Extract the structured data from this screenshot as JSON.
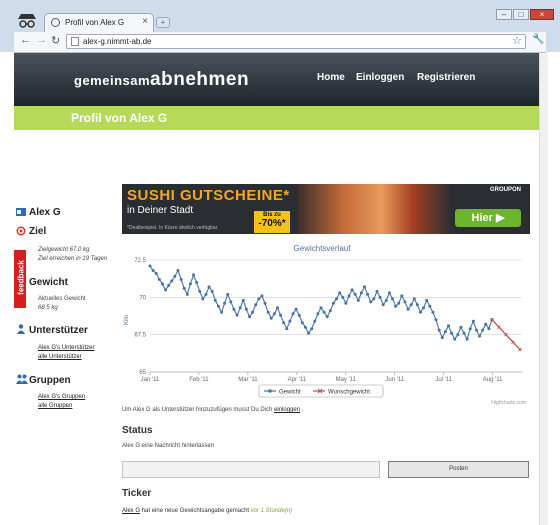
{
  "browser": {
    "tab_title": "Profil von Alex G",
    "tab_close": "×",
    "new_tab": "+",
    "url": "alex-g.nimmt-ab.de",
    "window_buttons": [
      "–",
      "□",
      "×"
    ]
  },
  "site": {
    "logo_prefix": "gemeinsam",
    "logo_main": "abnehmen",
    "nav": [
      "Home",
      "Einloggen",
      "Registrieren"
    ],
    "page_title": "Profil von Alex G"
  },
  "ad": {
    "headline": "SUSHI GUTSCHEINE*",
    "subline": "in Deiner Stadt",
    "footnote": "*Dealbeispiel. In Kürze ähnlich verfügbar.",
    "discount_label": "Bis zu",
    "discount_value": "-70%*",
    "brand": "GROUPON",
    "cta": "Hier ▶"
  },
  "sidebar": {
    "feedback": "feedback",
    "user_name": "Alex G",
    "goal_title": "Ziel",
    "goal_weight": "Zielgewicht 67.0 kg",
    "goal_end": "Ziel erreichen in 19 Tagen",
    "weight_title": "Gewicht",
    "current_label": "Aktuelles Gewicht",
    "current_value": "68.5 kg",
    "supporters_title": "Unterstützer",
    "supporters_link1": "Alex G's Unterstützer",
    "supporters_link2": "alle Unterstützer",
    "groups_title": "Gruppen",
    "groups_link1": "Alex G's Gruppen",
    "groups_link2": "alle Gruppen"
  },
  "chart_data": {
    "type": "line",
    "title": "Gewichtsverlauf",
    "ylabel": "Kilo",
    "xlabel": "",
    "x_ticks": [
      "Jan '11",
      "Feb '11",
      "Mar '11",
      "Apr '11",
      "May '11",
      "Jun '11",
      "Jul '11",
      "Aug '11"
    ],
    "y_ticks": [
      65,
      67.5,
      70,
      72.5
    ],
    "ylim": [
      65,
      72.5
    ],
    "legend": [
      "Gewicht",
      "Wunschgewicht"
    ],
    "credit": "Highcharts.com",
    "colors": {
      "weight": "#4572a7",
      "target": "#c0504d"
    },
    "series": [
      {
        "name": "Gewicht",
        "values": [
          72.1,
          71.8,
          71.6,
          71.2,
          70.9,
          70.5,
          70.8,
          71.1,
          71.4,
          71.8,
          71.2,
          70.6,
          70.2,
          70.9,
          71.5,
          71.0,
          70.4,
          69.9,
          70.2,
          70.7,
          70.4,
          69.8,
          69.4,
          69.0,
          69.6,
          70.2,
          69.7,
          69.2,
          68.8,
          69.3,
          69.8,
          69.2,
          68.7,
          69.0,
          69.5,
          69.9,
          70.1,
          69.6,
          69.0,
          68.6,
          68.9,
          69.3,
          68.8,
          68.3,
          67.9,
          68.4,
          68.9,
          69.2,
          68.8,
          68.3,
          68.0,
          67.6,
          67.9,
          68.4,
          68.9,
          69.3,
          69.0,
          68.7,
          69.1,
          69.6,
          69.9,
          70.3,
          70.0,
          69.6,
          70.1,
          70.5,
          70.2,
          69.8,
          70.3,
          70.7,
          70.2,
          69.7,
          69.9,
          70.4,
          70.0,
          69.5,
          69.8,
          70.3,
          69.9,
          69.4,
          69.6,
          70.1,
          69.7,
          69.2,
          69.5,
          69.9,
          69.5,
          69.0,
          69.3,
          69.8,
          69.4,
          69.0,
          68.5,
          67.8,
          67.3,
          67.7,
          68.1,
          67.6,
          67.2,
          67.5,
          68.0,
          67.6,
          67.2,
          67.9,
          68.4,
          67.8,
          67.4,
          67.8,
          68.2,
          67.9,
          68.5
        ]
      },
      {
        "name": "Wunschgewicht",
        "values": [
          68.5,
          68.0,
          67.5,
          67.0,
          66.5
        ]
      }
    ]
  },
  "main": {
    "supporter_note_pre": "Um Alex G als Unterstützer hinzuzufügen musst Du Dich ",
    "supporter_note_link": "einloggen",
    "supporter_note_post": " .",
    "status_title": "Status",
    "status_prompt": "Alex G eine Nachricht hinterlassen",
    "post_button": "Posten",
    "ticker_title": "Ticker",
    "ticker_user": "Alex G",
    "ticker_text": " hat eine neue Gewichtsangabe gemacht ",
    "ticker_time": "vor 1 Stunde(n)"
  }
}
